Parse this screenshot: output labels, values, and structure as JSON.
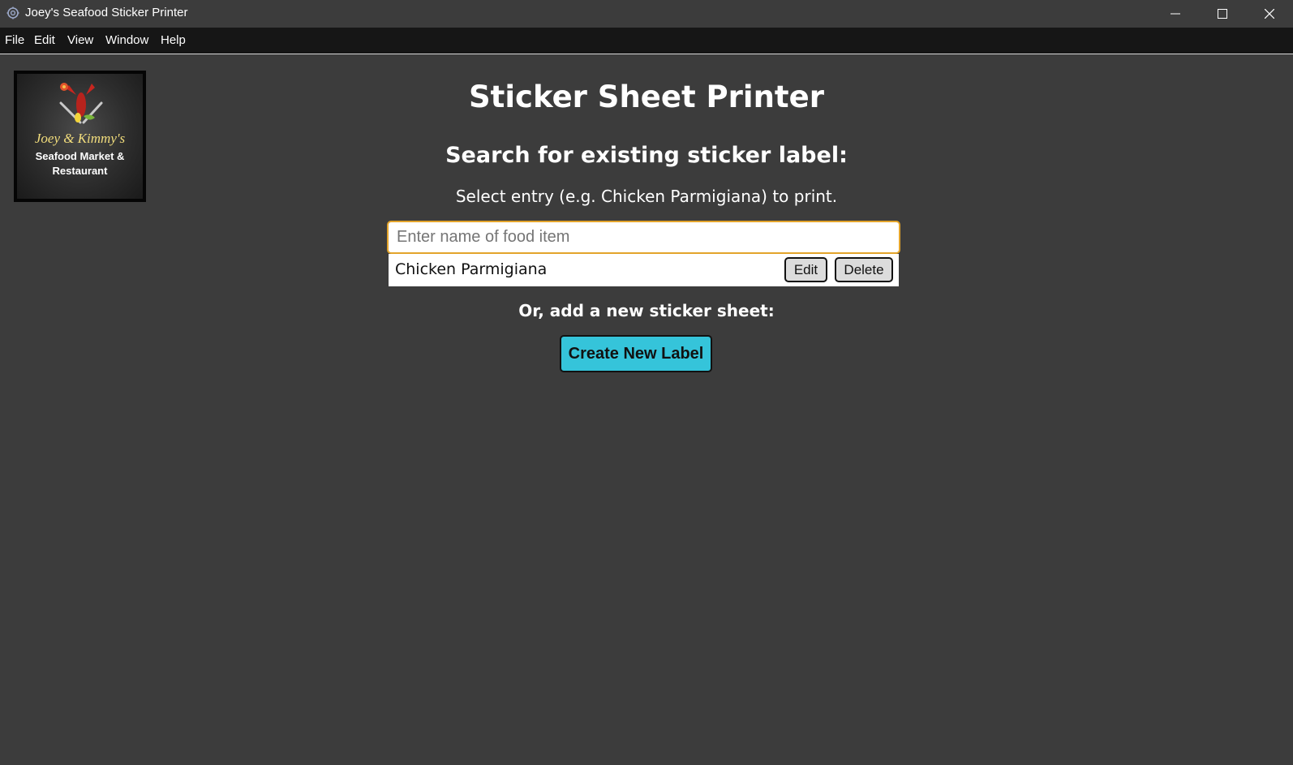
{
  "window": {
    "title": "Joey's Seafood Sticker Printer",
    "icon": "app-gear-icon",
    "controls": [
      "minimize-icon",
      "maximize-icon",
      "close-icon"
    ]
  },
  "menu": {
    "items": [
      {
        "label": "File"
      },
      {
        "label": "Edit"
      },
      {
        "label": "View"
      },
      {
        "label": "Window"
      },
      {
        "label": "Help"
      }
    ]
  },
  "logo": {
    "script_text": "Joey & Kimmy's",
    "line1": "Seafood Market &",
    "line2": "Restaurant"
  },
  "main": {
    "title": "Sticker Sheet Printer",
    "search_heading": "Search for existing sticker label:",
    "search_hint": "Select entry (e.g. Chicken Parmigiana) to print.",
    "search": {
      "value": "",
      "placeholder": "Enter name of food item"
    },
    "results": [
      {
        "name": "Chicken Parmigiana",
        "edit_label": "Edit",
        "delete_label": "Delete"
      }
    ],
    "add_heading": "Or, add a new sticker sheet:",
    "create_label": "Create New Label"
  },
  "colors": {
    "background": "#3c3c3c",
    "menubar": "#161616",
    "accent_button": "#35c4da",
    "input_focus_border": "#e3a42b"
  }
}
